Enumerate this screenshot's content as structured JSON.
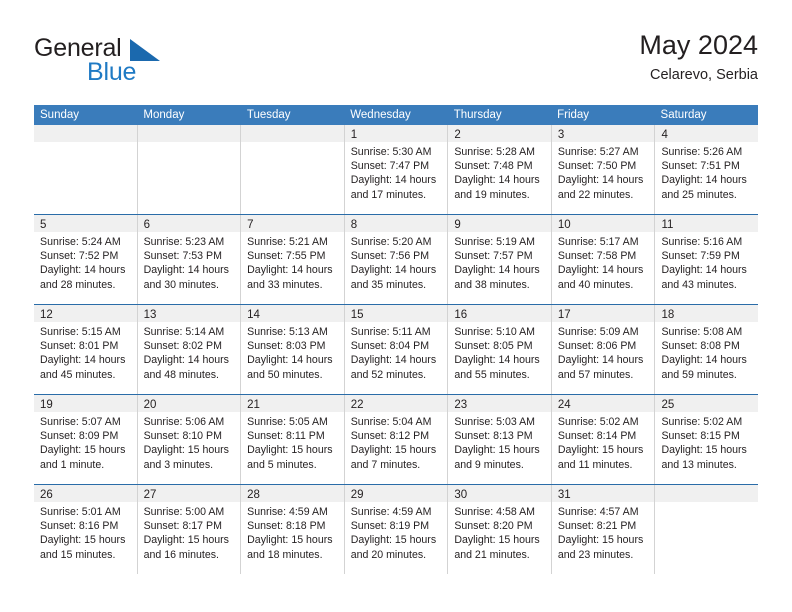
{
  "brand": {
    "word_one": "General",
    "word_two": "Blue",
    "triangle_icon": "triangle-logo-icon",
    "accent_color": "#1f7ac4",
    "triangle_color": "#1b69ae"
  },
  "header": {
    "title": "May 2024",
    "subtitle": "Celarevo, Serbia"
  },
  "colors": {
    "header_blue": "#3a7cbb",
    "week_divider": "#2a6ca8",
    "day_band_gray": "#f0f0f0",
    "column_divider": "#d3d3d3",
    "text": "#231f20"
  },
  "weekdays": [
    "Sunday",
    "Monday",
    "Tuesday",
    "Wednesday",
    "Thursday",
    "Friday",
    "Saturday"
  ],
  "weeks": [
    [
      {
        "day": "",
        "lines": []
      },
      {
        "day": "",
        "lines": []
      },
      {
        "day": "",
        "lines": []
      },
      {
        "day": "1",
        "lines": [
          "Sunrise: 5:30 AM",
          "Sunset: 7:47 PM",
          "Daylight: 14 hours",
          "and 17 minutes."
        ]
      },
      {
        "day": "2",
        "lines": [
          "Sunrise: 5:28 AM",
          "Sunset: 7:48 PM",
          "Daylight: 14 hours",
          "and 19 minutes."
        ]
      },
      {
        "day": "3",
        "lines": [
          "Sunrise: 5:27 AM",
          "Sunset: 7:50 PM",
          "Daylight: 14 hours",
          "and 22 minutes."
        ]
      },
      {
        "day": "4",
        "lines": [
          "Sunrise: 5:26 AM",
          "Sunset: 7:51 PM",
          "Daylight: 14 hours",
          "and 25 minutes."
        ]
      }
    ],
    [
      {
        "day": "5",
        "lines": [
          "Sunrise: 5:24 AM",
          "Sunset: 7:52 PM",
          "Daylight: 14 hours",
          "and 28 minutes."
        ]
      },
      {
        "day": "6",
        "lines": [
          "Sunrise: 5:23 AM",
          "Sunset: 7:53 PM",
          "Daylight: 14 hours",
          "and 30 minutes."
        ]
      },
      {
        "day": "7",
        "lines": [
          "Sunrise: 5:21 AM",
          "Sunset: 7:55 PM",
          "Daylight: 14 hours",
          "and 33 minutes."
        ]
      },
      {
        "day": "8",
        "lines": [
          "Sunrise: 5:20 AM",
          "Sunset: 7:56 PM",
          "Daylight: 14 hours",
          "and 35 minutes."
        ]
      },
      {
        "day": "9",
        "lines": [
          "Sunrise: 5:19 AM",
          "Sunset: 7:57 PM",
          "Daylight: 14 hours",
          "and 38 minutes."
        ]
      },
      {
        "day": "10",
        "lines": [
          "Sunrise: 5:17 AM",
          "Sunset: 7:58 PM",
          "Daylight: 14 hours",
          "and 40 minutes."
        ]
      },
      {
        "day": "11",
        "lines": [
          "Sunrise: 5:16 AM",
          "Sunset: 7:59 PM",
          "Daylight: 14 hours",
          "and 43 minutes."
        ]
      }
    ],
    [
      {
        "day": "12",
        "lines": [
          "Sunrise: 5:15 AM",
          "Sunset: 8:01 PM",
          "Daylight: 14 hours",
          "and 45 minutes."
        ]
      },
      {
        "day": "13",
        "lines": [
          "Sunrise: 5:14 AM",
          "Sunset: 8:02 PM",
          "Daylight: 14 hours",
          "and 48 minutes."
        ]
      },
      {
        "day": "14",
        "lines": [
          "Sunrise: 5:13 AM",
          "Sunset: 8:03 PM",
          "Daylight: 14 hours",
          "and 50 minutes."
        ]
      },
      {
        "day": "15",
        "lines": [
          "Sunrise: 5:11 AM",
          "Sunset: 8:04 PM",
          "Daylight: 14 hours",
          "and 52 minutes."
        ]
      },
      {
        "day": "16",
        "lines": [
          "Sunrise: 5:10 AM",
          "Sunset: 8:05 PM",
          "Daylight: 14 hours",
          "and 55 minutes."
        ]
      },
      {
        "day": "17",
        "lines": [
          "Sunrise: 5:09 AM",
          "Sunset: 8:06 PM",
          "Daylight: 14 hours",
          "and 57 minutes."
        ]
      },
      {
        "day": "18",
        "lines": [
          "Sunrise: 5:08 AM",
          "Sunset: 8:08 PM",
          "Daylight: 14 hours",
          "and 59 minutes."
        ]
      }
    ],
    [
      {
        "day": "19",
        "lines": [
          "Sunrise: 5:07 AM",
          "Sunset: 8:09 PM",
          "Daylight: 15 hours",
          "and 1 minute."
        ]
      },
      {
        "day": "20",
        "lines": [
          "Sunrise: 5:06 AM",
          "Sunset: 8:10 PM",
          "Daylight: 15 hours",
          "and 3 minutes."
        ]
      },
      {
        "day": "21",
        "lines": [
          "Sunrise: 5:05 AM",
          "Sunset: 8:11 PM",
          "Daylight: 15 hours",
          "and 5 minutes."
        ]
      },
      {
        "day": "22",
        "lines": [
          "Sunrise: 5:04 AM",
          "Sunset: 8:12 PM",
          "Daylight: 15 hours",
          "and 7 minutes."
        ]
      },
      {
        "day": "23",
        "lines": [
          "Sunrise: 5:03 AM",
          "Sunset: 8:13 PM",
          "Daylight: 15 hours",
          "and 9 minutes."
        ]
      },
      {
        "day": "24",
        "lines": [
          "Sunrise: 5:02 AM",
          "Sunset: 8:14 PM",
          "Daylight: 15 hours",
          "and 11 minutes."
        ]
      },
      {
        "day": "25",
        "lines": [
          "Sunrise: 5:02 AM",
          "Sunset: 8:15 PM",
          "Daylight: 15 hours",
          "and 13 minutes."
        ]
      }
    ],
    [
      {
        "day": "26",
        "lines": [
          "Sunrise: 5:01 AM",
          "Sunset: 8:16 PM",
          "Daylight: 15 hours",
          "and 15 minutes."
        ]
      },
      {
        "day": "27",
        "lines": [
          "Sunrise: 5:00 AM",
          "Sunset: 8:17 PM",
          "Daylight: 15 hours",
          "and 16 minutes."
        ]
      },
      {
        "day": "28",
        "lines": [
          "Sunrise: 4:59 AM",
          "Sunset: 8:18 PM",
          "Daylight: 15 hours",
          "and 18 minutes."
        ]
      },
      {
        "day": "29",
        "lines": [
          "Sunrise: 4:59 AM",
          "Sunset: 8:19 PM",
          "Daylight: 15 hours",
          "and 20 minutes."
        ]
      },
      {
        "day": "30",
        "lines": [
          "Sunrise: 4:58 AM",
          "Sunset: 8:20 PM",
          "Daylight: 15 hours",
          "and 21 minutes."
        ]
      },
      {
        "day": "31",
        "lines": [
          "Sunrise: 4:57 AM",
          "Sunset: 8:21 PM",
          "Daylight: 15 hours",
          "and 23 minutes."
        ]
      },
      {
        "day": "",
        "lines": []
      }
    ]
  ]
}
